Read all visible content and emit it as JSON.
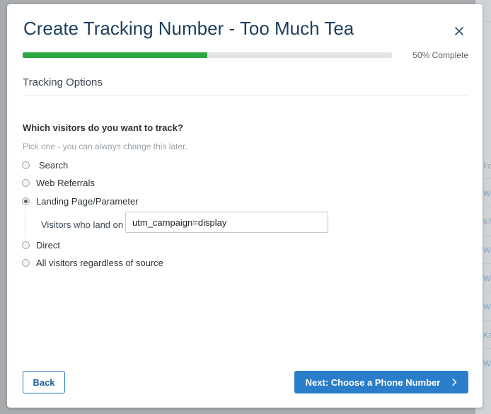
{
  "background": {
    "snippets": [
      {
        "text": "Fo",
        "tone": "grey"
      },
      {
        "text": "W",
        "tone": "link"
      },
      {
        "text": "67",
        "tone": "link"
      },
      {
        "text": "W",
        "tone": "link"
      },
      {
        "text": "W",
        "tone": "link"
      },
      {
        "text": "W",
        "tone": "link"
      },
      {
        "text": "Ka",
        "tone": "link"
      },
      {
        "text": "W",
        "tone": "link"
      }
    ]
  },
  "modal": {
    "title": "Create Tracking Number - Too Much Tea",
    "close_icon": "close-icon"
  },
  "progress": {
    "percent": 50,
    "label": "50% Complete",
    "fill_color": "#2fa741"
  },
  "section": {
    "title": "Tracking Options"
  },
  "form": {
    "question": "Which visitors do you want to track?",
    "hint": "Pick one - you can always change this later.",
    "options": [
      {
        "label": "Search",
        "checked": false
      },
      {
        "label": "Web Referrals",
        "checked": false
      },
      {
        "label": "Landing Page/Parameter",
        "checked": true
      },
      {
        "label": "Direct",
        "checked": false
      },
      {
        "label": "All visitors regardless of source",
        "checked": false
      }
    ],
    "landing": {
      "label": "Visitors who land on",
      "value": "utm_campaign=display"
    }
  },
  "footer": {
    "back_label": "Back",
    "next_label": "Next: Choose a Phone Number",
    "next_icon": "chevron-right-icon",
    "accent_color": "#2a7dc9"
  }
}
